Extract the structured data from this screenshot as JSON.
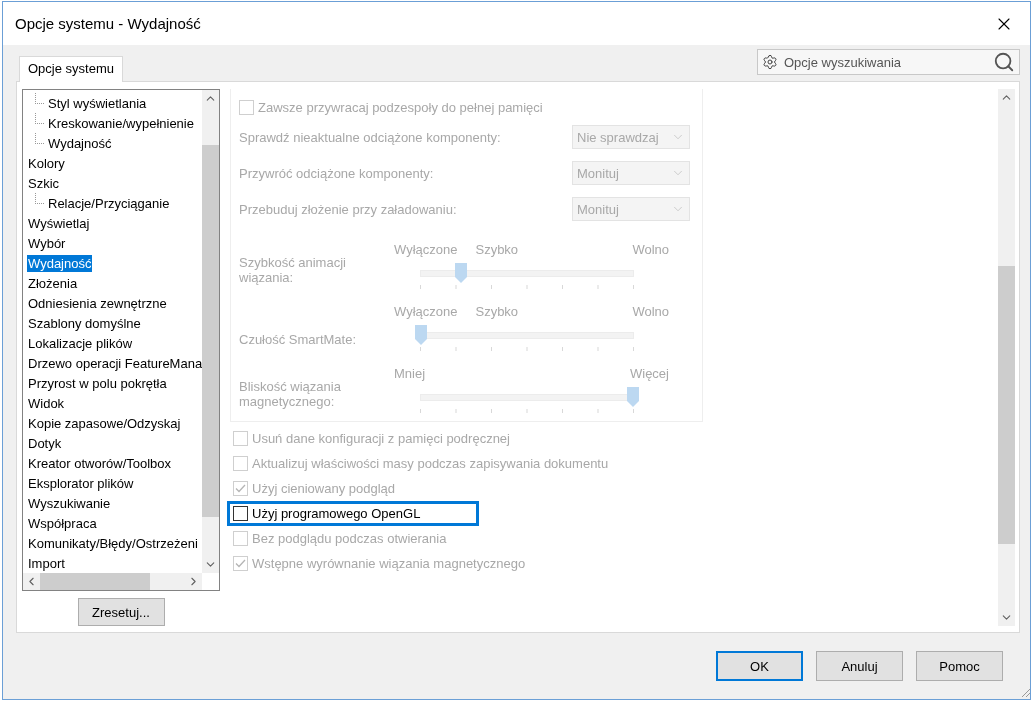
{
  "window": {
    "title": "Opcje systemu - Wydajność"
  },
  "search": {
    "placeholder": "Opcje wyszukiwania"
  },
  "tabs": [
    {
      "label": "Opcje systemu",
      "selected": true
    }
  ],
  "tree": {
    "items": [
      {
        "children": [
          {
            "label": "Styl wyświetlania",
            "selected": false
          },
          {
            "label": "Kreskowanie/wypełnienie",
            "selected": false
          },
          {
            "label": "Wydajność",
            "selected": false
          }
        ]
      },
      {
        "label": "Kolory",
        "selected": false
      },
      {
        "label": "Szkic",
        "selected": false,
        "children": [
          {
            "label": "Relacje/Przyciąganie",
            "selected": false
          }
        ]
      },
      {
        "label": "Wyświetlaj",
        "selected": false
      },
      {
        "label": "Wybór",
        "selected": false
      },
      {
        "label": "Wydajność",
        "selected": true
      },
      {
        "label": "Złożenia",
        "selected": false
      },
      {
        "label": "Odniesienia zewnętrzne",
        "selected": false
      },
      {
        "label": "Szablony domyślne",
        "selected": false
      },
      {
        "label": "Lokalizacje plików",
        "selected": false
      },
      {
        "label": "Drzewo operacji FeatureMana",
        "selected": false
      },
      {
        "label": "Przyrost w polu pokrętła",
        "selected": false
      },
      {
        "label": "Widok",
        "selected": false
      },
      {
        "label": "Kopie zapasowe/Odzyskaj",
        "selected": false
      },
      {
        "label": "Dotyk",
        "selected": false
      },
      {
        "label": "Kreator otworów/Toolbox",
        "selected": false
      },
      {
        "label": "Eksplorator plików",
        "selected": false
      },
      {
        "label": "Wyszukiwanie",
        "selected": false
      },
      {
        "label": "Współpraca",
        "selected": false
      },
      {
        "label": "Komunikaty/Błędy/Ostrzeżeni",
        "selected": false
      },
      {
        "label": "Import",
        "selected": false
      }
    ]
  },
  "reset_button": "Zresetuj...",
  "group": [
    {
      "kind": "checkbox",
      "label": "Zawsze przywracaj podzespoły do pełnej pamięci",
      "checked": false,
      "disabled": true
    },
    {
      "kind": "dropdown",
      "label": "Sprawdź nieaktualne odciążone komponenty:",
      "value": "Nie sprawdzaj",
      "disabled": true
    },
    {
      "kind": "dropdown",
      "label": "Przywróć odciążone komponenty:",
      "value": "Monituj",
      "disabled": true
    },
    {
      "kind": "dropdown",
      "label": "Przebuduj złożenie przy załadowaniu:",
      "value": "Monituj",
      "disabled": true
    },
    {
      "kind": "slider",
      "label": "Szybkość animacji wiązania:",
      "scale": [
        "Wyłączone",
        "Szybko",
        "Wolno"
      ],
      "level": 0.19,
      "disabled": true
    },
    {
      "kind": "slider",
      "label": "Czułość SmartMate:",
      "scale": [
        "Wyłączone",
        "Szybko",
        "Wolno"
      ],
      "level": 0,
      "disabled": true
    },
    {
      "kind": "slider",
      "label": "Bliskość wiązania magnetycznego:",
      "scale": [
        "Mniej",
        "Więcej"
      ],
      "level": 1,
      "disabled": true
    }
  ],
  "options": [
    {
      "label": "Usuń dane konfiguracji z pamięci podręcznej",
      "checked": false,
      "disabled": true,
      "focused": false
    },
    {
      "label": "Aktualizuj właściwości masy podczas zapisywania dokumentu",
      "checked": false,
      "disabled": true,
      "focused": false
    },
    {
      "label": "Użyj cieniowany podgląd",
      "checked": true,
      "disabled": true,
      "focused": false
    },
    {
      "label": "Użyj programowego OpenGL",
      "checked": false,
      "disabled": false,
      "focused": true
    },
    {
      "label": "Bez podglądu podczas otwierania",
      "checked": false,
      "disabled": true,
      "focused": false
    },
    {
      "label": "Wstępne wyrównanie wiązania magnetycznego",
      "checked": true,
      "disabled": true,
      "focused": false
    }
  ],
  "buttons": [
    {
      "label": "OK",
      "default": true
    },
    {
      "label": "Anuluj",
      "default": false
    },
    {
      "label": "Pomoc",
      "default": false
    }
  ]
}
